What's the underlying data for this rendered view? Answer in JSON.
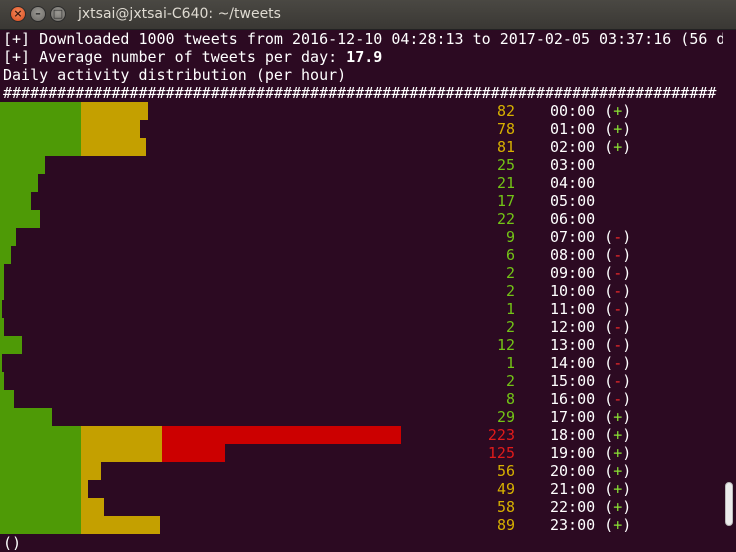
{
  "window": {
    "title": "jxtsai@jxtsai-C640: ~/tweets"
  },
  "terminal": {
    "header_lines": [
      "[+] Downloaded 1000 tweets from 2016-12-10 04:28:13 to 2017-02-05 03:37:16 (56 d",
      "[+] Average number of tweets per day: ",
      "Daily activity distribution (per hour)"
    ],
    "avg_value": "17.9",
    "separator": "###############################################################################",
    "prompt": "()"
  },
  "colors": {
    "green": "#4e9a06",
    "yellow": "#c4a000",
    "red": "#cc0000",
    "background": "#2c0a22"
  },
  "hours": [
    {
      "count": 82,
      "label": "82",
      "hour": "00:00",
      "flag": "+"
    },
    {
      "count": 78,
      "label": "78",
      "hour": "01:00",
      "flag": "+"
    },
    {
      "count": 81,
      "label": "81",
      "hour": "02:00",
      "flag": "+"
    },
    {
      "count": 25,
      "label": "25",
      "hour": "03:00",
      "flag": ""
    },
    {
      "count": 21,
      "label": "21",
      "hour": "04:00",
      "flag": ""
    },
    {
      "count": 17,
      "label": "17",
      "hour": "05:00",
      "flag": ""
    },
    {
      "count": 22,
      "label": "22",
      "hour": "06:00",
      "flag": ""
    },
    {
      "count": 9,
      "label": "9",
      "hour": "07:00",
      "flag": "-"
    },
    {
      "count": 6,
      "label": "6",
      "hour": "08:00",
      "flag": "-"
    },
    {
      "count": 2,
      "label": "2",
      "hour": "09:00",
      "flag": "-"
    },
    {
      "count": 2,
      "label": "2",
      "hour": "10:00",
      "flag": "-"
    },
    {
      "count": 1,
      "label": "1",
      "hour": "11:00",
      "flag": "-"
    },
    {
      "count": 2,
      "label": "2",
      "hour": "12:00",
      "flag": "-"
    },
    {
      "count": 12,
      "label": "12",
      "hour": "13:00",
      "flag": "-"
    },
    {
      "count": 1,
      "label": "1",
      "hour": "14:00",
      "flag": "-"
    },
    {
      "count": 2,
      "label": "2",
      "hour": "15:00",
      "flag": "-"
    },
    {
      "count": 8,
      "label": "8",
      "hour": "16:00",
      "flag": "-"
    },
    {
      "count": 29,
      "label": "29",
      "hour": "17:00",
      "flag": "+"
    },
    {
      "count": 223,
      "label": "223",
      "hour": "18:00",
      "flag": "+"
    },
    {
      "count": 125,
      "label": "125",
      "hour": "19:00",
      "flag": "+"
    },
    {
      "count": 56,
      "label": "56",
      "hour": "20:00",
      "flag": "+"
    },
    {
      "count": 49,
      "label": "49",
      "hour": "21:00",
      "flag": "+"
    },
    {
      "count": 58,
      "label": "58",
      "hour": "22:00",
      "flag": "+"
    },
    {
      "count": 89,
      "label": "89",
      "hour": "23:00",
      "flag": "+"
    }
  ]
}
